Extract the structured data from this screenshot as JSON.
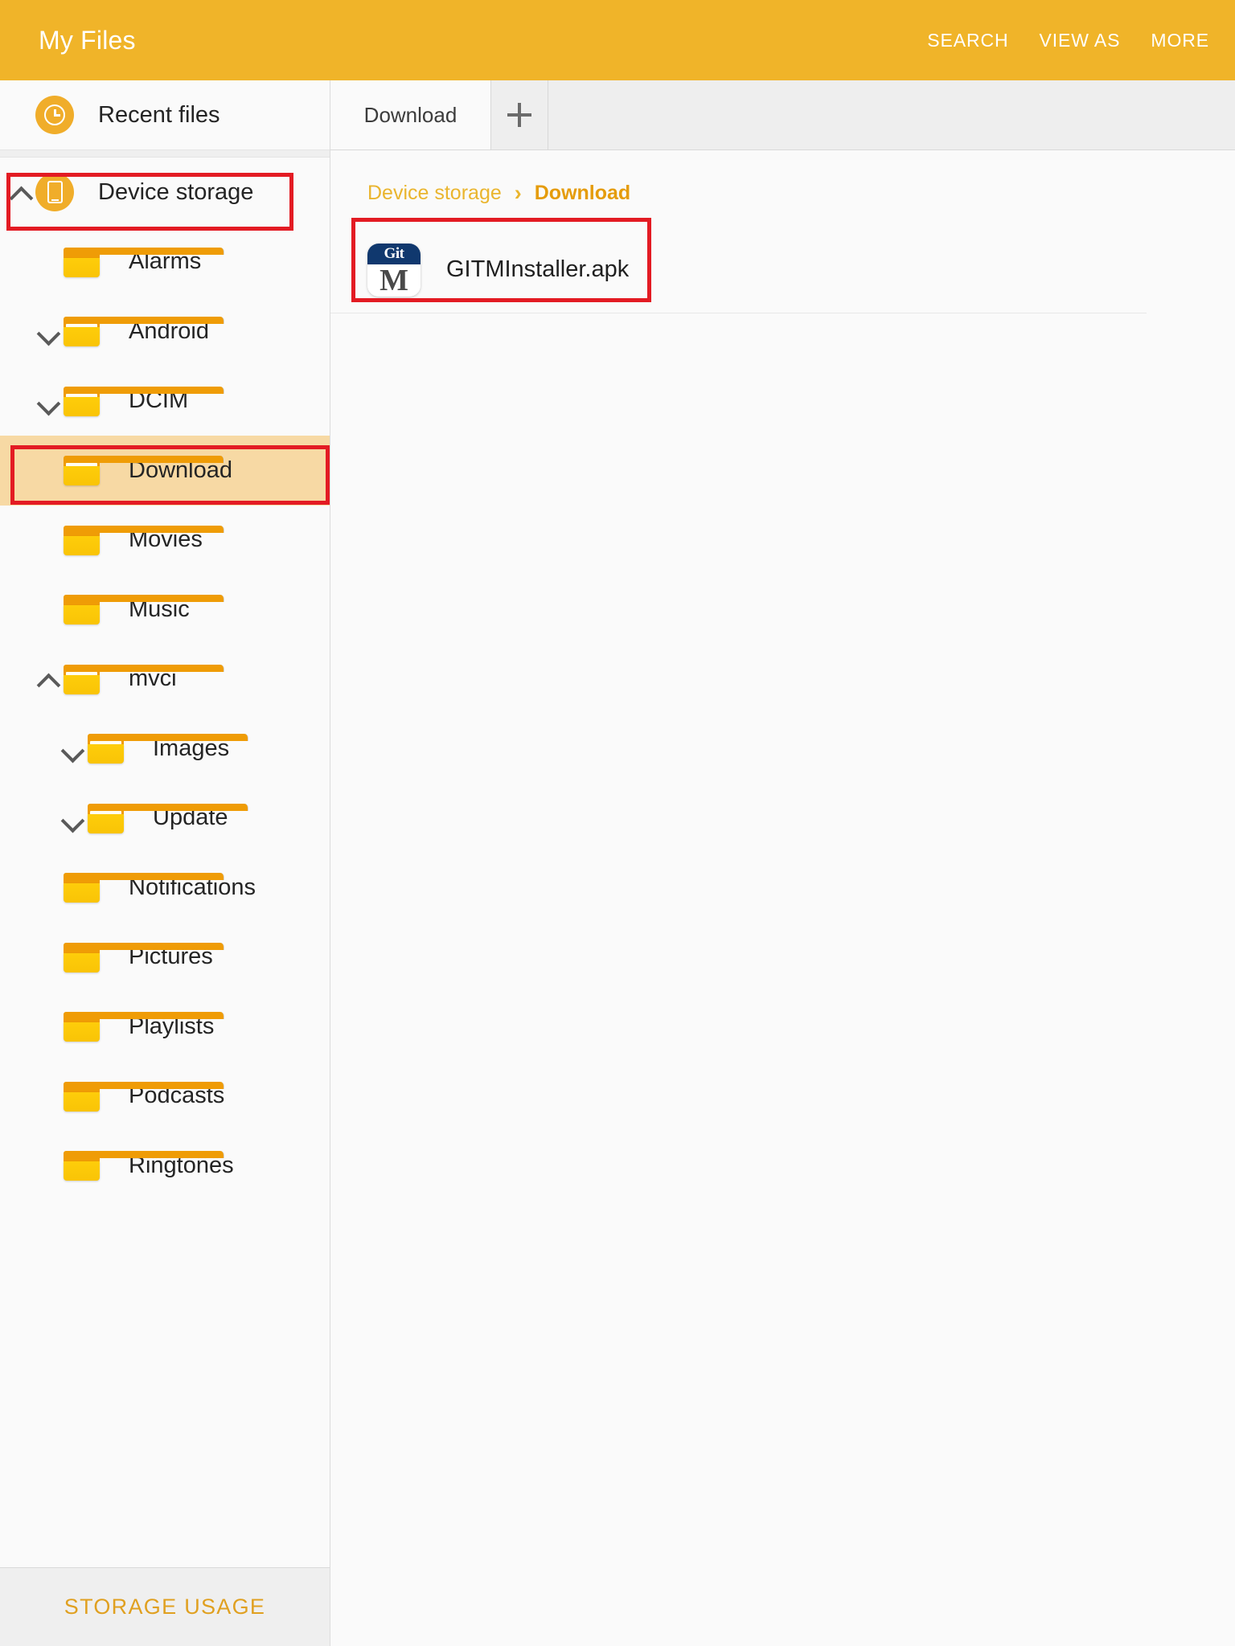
{
  "appbar": {
    "title": "My Files",
    "actions": [
      {
        "label": "SEARCH",
        "name": "search"
      },
      {
        "label": "VIEW AS",
        "name": "view-as"
      },
      {
        "label": "MORE",
        "name": "more"
      }
    ]
  },
  "sidebar": {
    "recent": {
      "label": "Recent files",
      "icon": "clock-icon"
    },
    "device": {
      "label": "Device storage",
      "icon": "phone-icon",
      "chevron": "up"
    },
    "items": [
      {
        "label": "Alarms",
        "chevron": "none",
        "indent": 1,
        "has_sub": false
      },
      {
        "label": "Android",
        "chevron": "down",
        "indent": 1,
        "has_sub": true
      },
      {
        "label": "DCIM",
        "chevron": "down",
        "indent": 1,
        "has_sub": true
      },
      {
        "label": "Download",
        "chevron": "none",
        "indent": 1,
        "has_sub": true,
        "selected": true
      },
      {
        "label": "Movies",
        "chevron": "none",
        "indent": 1,
        "has_sub": false
      },
      {
        "label": "Music",
        "chevron": "none",
        "indent": 1,
        "has_sub": false
      },
      {
        "label": "mvci",
        "chevron": "up",
        "indent": 1,
        "has_sub": true
      },
      {
        "label": "Images",
        "chevron": "down",
        "indent": 2,
        "has_sub": true
      },
      {
        "label": "Update",
        "chevron": "down",
        "indent": 2,
        "has_sub": true
      },
      {
        "label": "Notifications",
        "chevron": "none",
        "indent": 1,
        "has_sub": false
      },
      {
        "label": "Pictures",
        "chevron": "none",
        "indent": 1,
        "has_sub": false
      },
      {
        "label": "Playlists",
        "chevron": "none",
        "indent": 1,
        "has_sub": false
      },
      {
        "label": "Podcasts",
        "chevron": "none",
        "indent": 1,
        "has_sub": false
      },
      {
        "label": "Ringtones",
        "chevron": "none",
        "indent": 1,
        "has_sub": false
      }
    ],
    "footer": {
      "label": "STORAGE USAGE"
    }
  },
  "main": {
    "tabs": [
      {
        "label": "Download",
        "active": true
      }
    ],
    "add_tab_icon": "plus-icon",
    "breadcrumb": [
      {
        "label": "Device storage",
        "current": false
      },
      {
        "label": "Download",
        "current": true
      }
    ],
    "breadcrumb_separator": "›",
    "files": [
      {
        "name": "GITMInstaller.apk",
        "icon_top_text": "Git",
        "icon_bottom_text": "M",
        "icon_top_color": "#10386e"
      }
    ]
  },
  "colors": {
    "appbar": "#f0b429",
    "accent": "#eab52e",
    "selection": "#f7d9a4",
    "annotation": "#e31b23",
    "folder_body": "#fdcb09",
    "folder_tab": "#ef9c06"
  }
}
